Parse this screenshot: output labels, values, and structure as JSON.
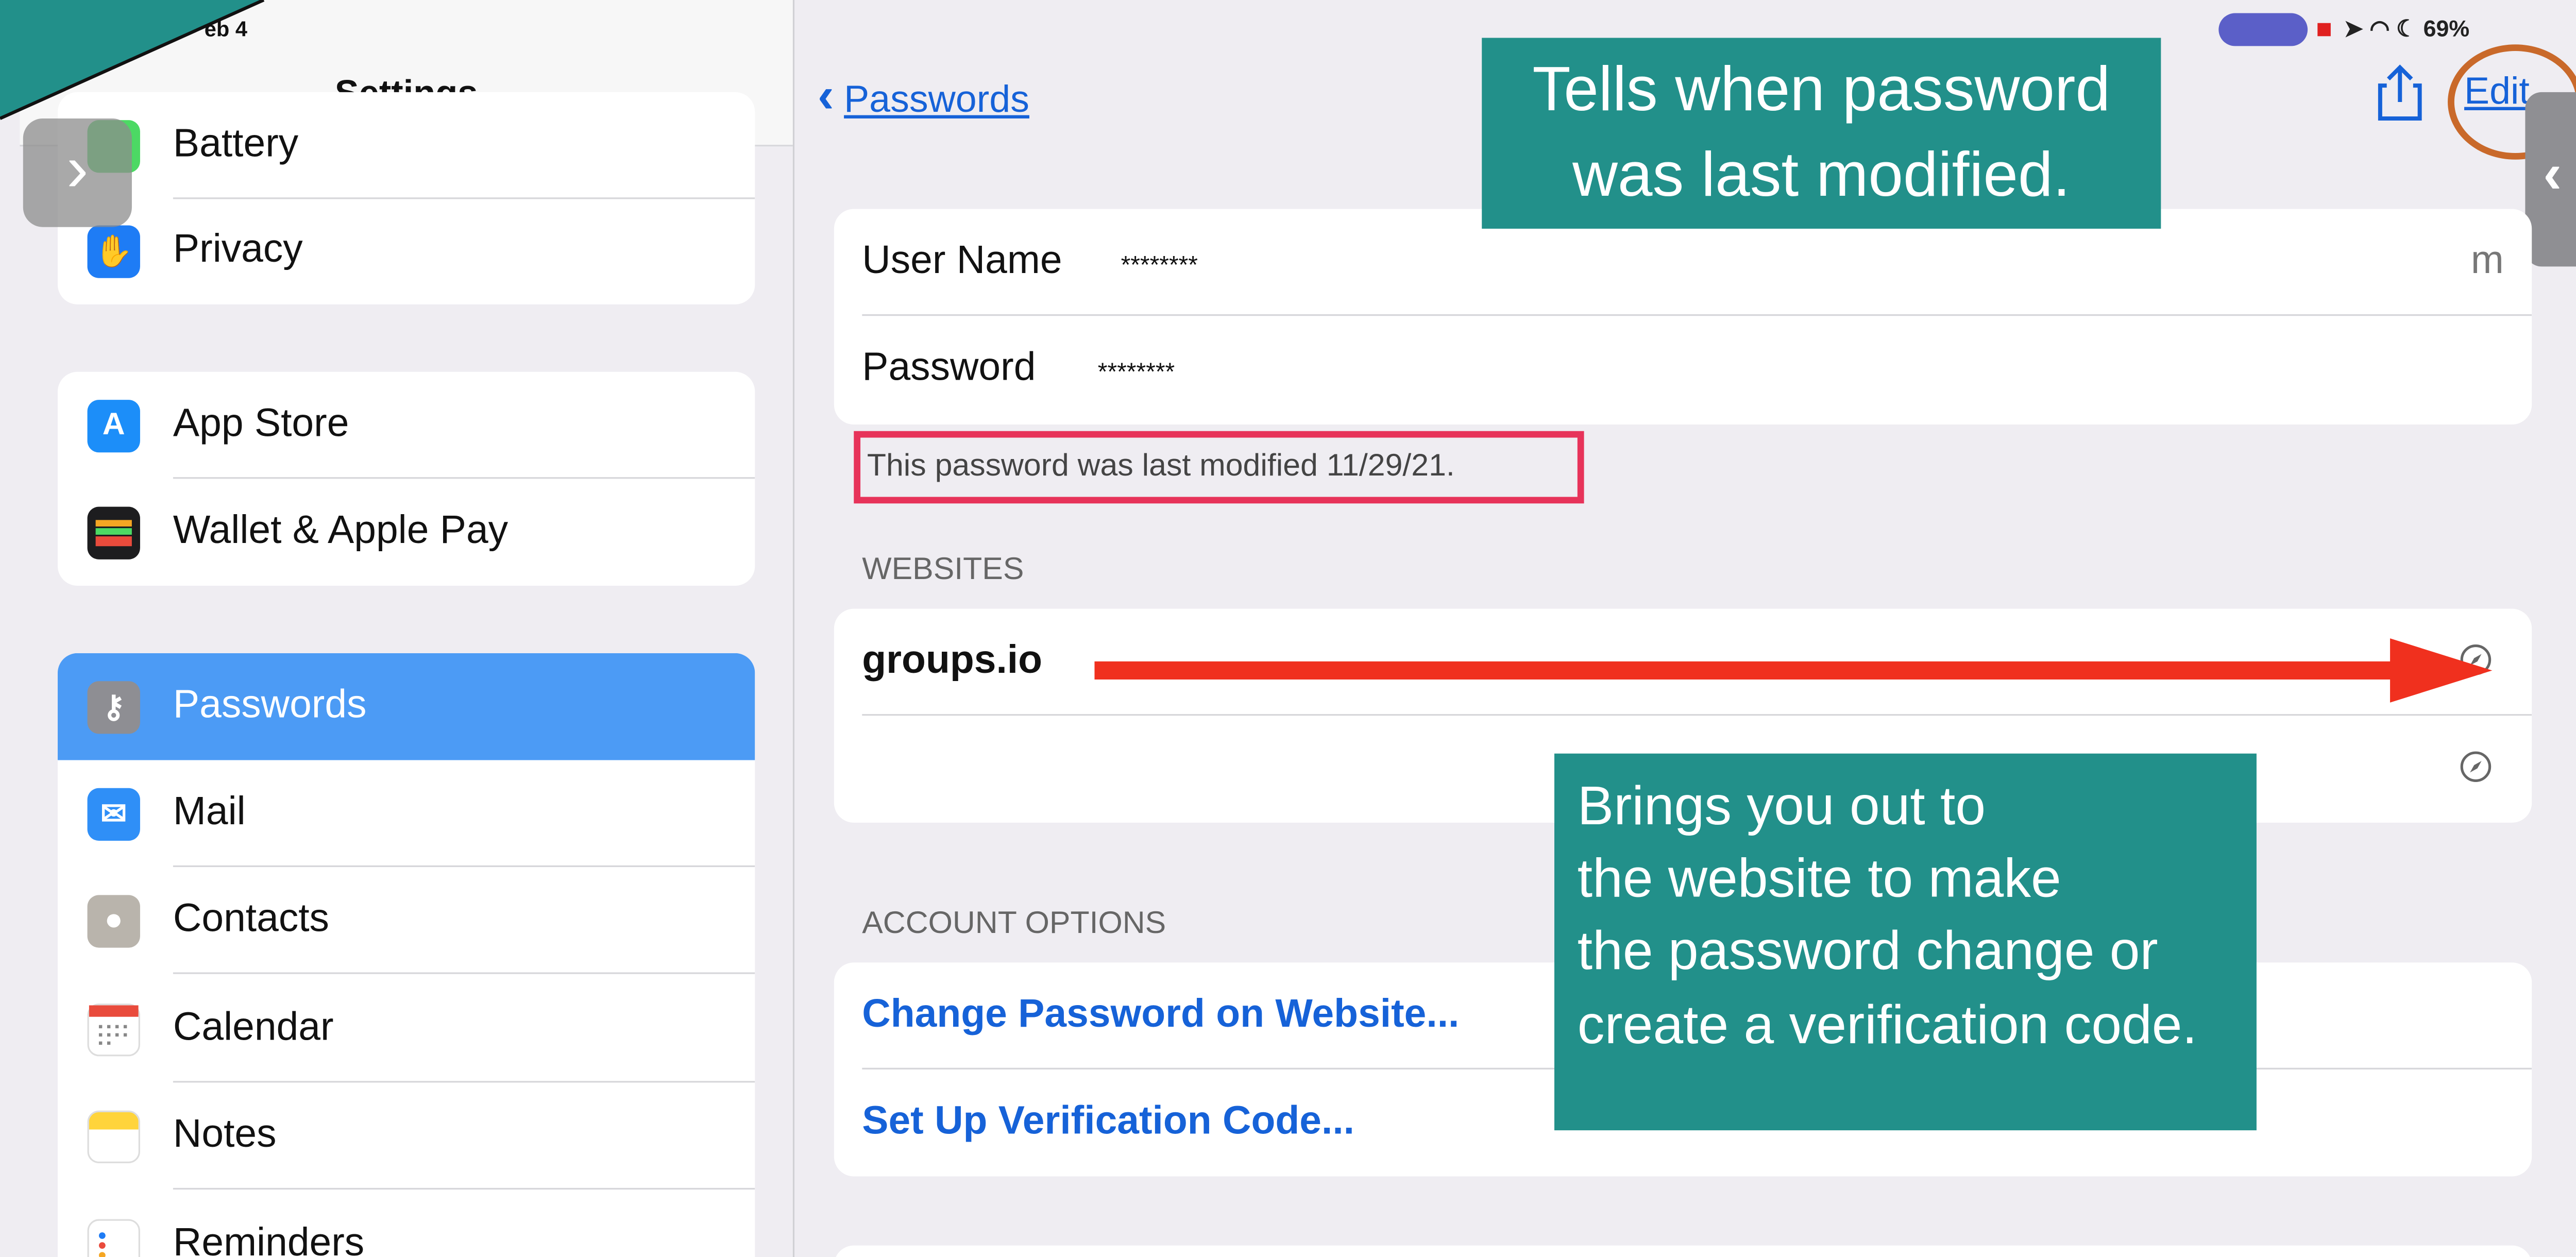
{
  "status": {
    "date_fragment": "eb 4",
    "battery": "69%"
  },
  "sidebar": {
    "title": "Settings",
    "groups": [
      {
        "items": [
          {
            "label": "Battery",
            "icon": "battery-icon",
            "color": "#4cd964"
          },
          {
            "label": "Privacy",
            "icon": "hand-icon",
            "color": "#1e7cf5"
          }
        ]
      },
      {
        "items": [
          {
            "label": "App Store",
            "icon": "app-store-icon",
            "color": "#1c8ef9"
          },
          {
            "label": "Wallet & Apple Pay",
            "icon": "wallet-icon",
            "color": "#1d1d1f"
          }
        ]
      },
      {
        "items": [
          {
            "label": "Passwords",
            "icon": "key-icon",
            "color": "#8e8e93",
            "selected": true
          },
          {
            "label": "Mail",
            "icon": "mail-icon",
            "color": "#2f8ff7"
          },
          {
            "label": "Contacts",
            "icon": "contacts-icon",
            "color": "#b9b4ac"
          },
          {
            "label": "Calendar",
            "icon": "calendar-icon",
            "color": "#ffffff"
          },
          {
            "label": "Notes",
            "icon": "notes-icon",
            "color": "#ffd43b"
          },
          {
            "label": "Reminders",
            "icon": "reminders-icon",
            "color": "#ffffff"
          }
        ]
      }
    ]
  },
  "detail": {
    "back_label": "Passwords",
    "edit_label": "Edit",
    "credentials": [
      {
        "key": "User Name",
        "value": "********",
        "trailing": "m"
      },
      {
        "key": "Password",
        "value": "********"
      }
    ],
    "modified_note": "This password was last modified 11/29/21.",
    "websites_header": "WEBSITES",
    "websites": [
      "groups.io",
      ""
    ],
    "account_options_header": "ACCOUNT OPTIONS",
    "account_options": [
      "Change Password on Website...",
      "Set Up Verification Code..."
    ]
  },
  "annotations": {
    "callout_top": [
      "Tells when password",
      "was last modified."
    ],
    "callout_bottom": [
      "Brings you out to",
      "the website to make",
      "the password change or",
      "create a verification code."
    ],
    "callout_color": "#22908a",
    "highlight_box_color": "#e7335a",
    "arrow_color": "#f0301e",
    "edit_circle_color": "#c9692a"
  },
  "colors": {
    "accent": "#1662d8",
    "selected_row": "#4c9bf5"
  }
}
